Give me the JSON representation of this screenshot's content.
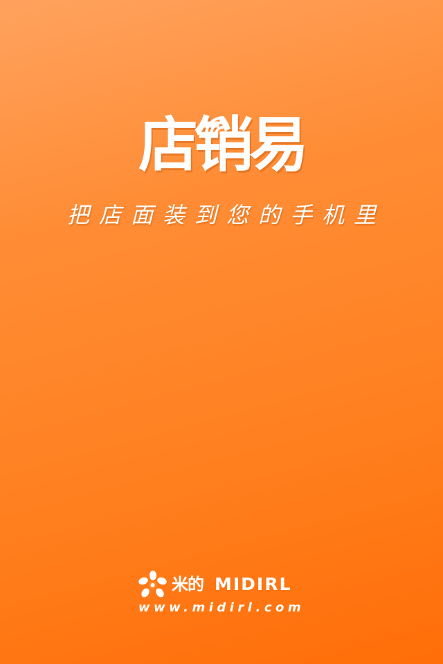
{
  "app": {
    "logo_text": "店销易",
    "tagline": "把店面装到您的手机里"
  },
  "icons": {
    "logo_signal": "wifi-signal-icon",
    "brand_mark": "midirl-flower-icon"
  },
  "footer": {
    "brand_cn": "米的",
    "brand_en": "MIDIRL",
    "url": "www.midirl.com"
  },
  "colors": {
    "background_top": "#ffa25e",
    "background_bottom": "#ff6e08",
    "text": "#ffffff"
  }
}
